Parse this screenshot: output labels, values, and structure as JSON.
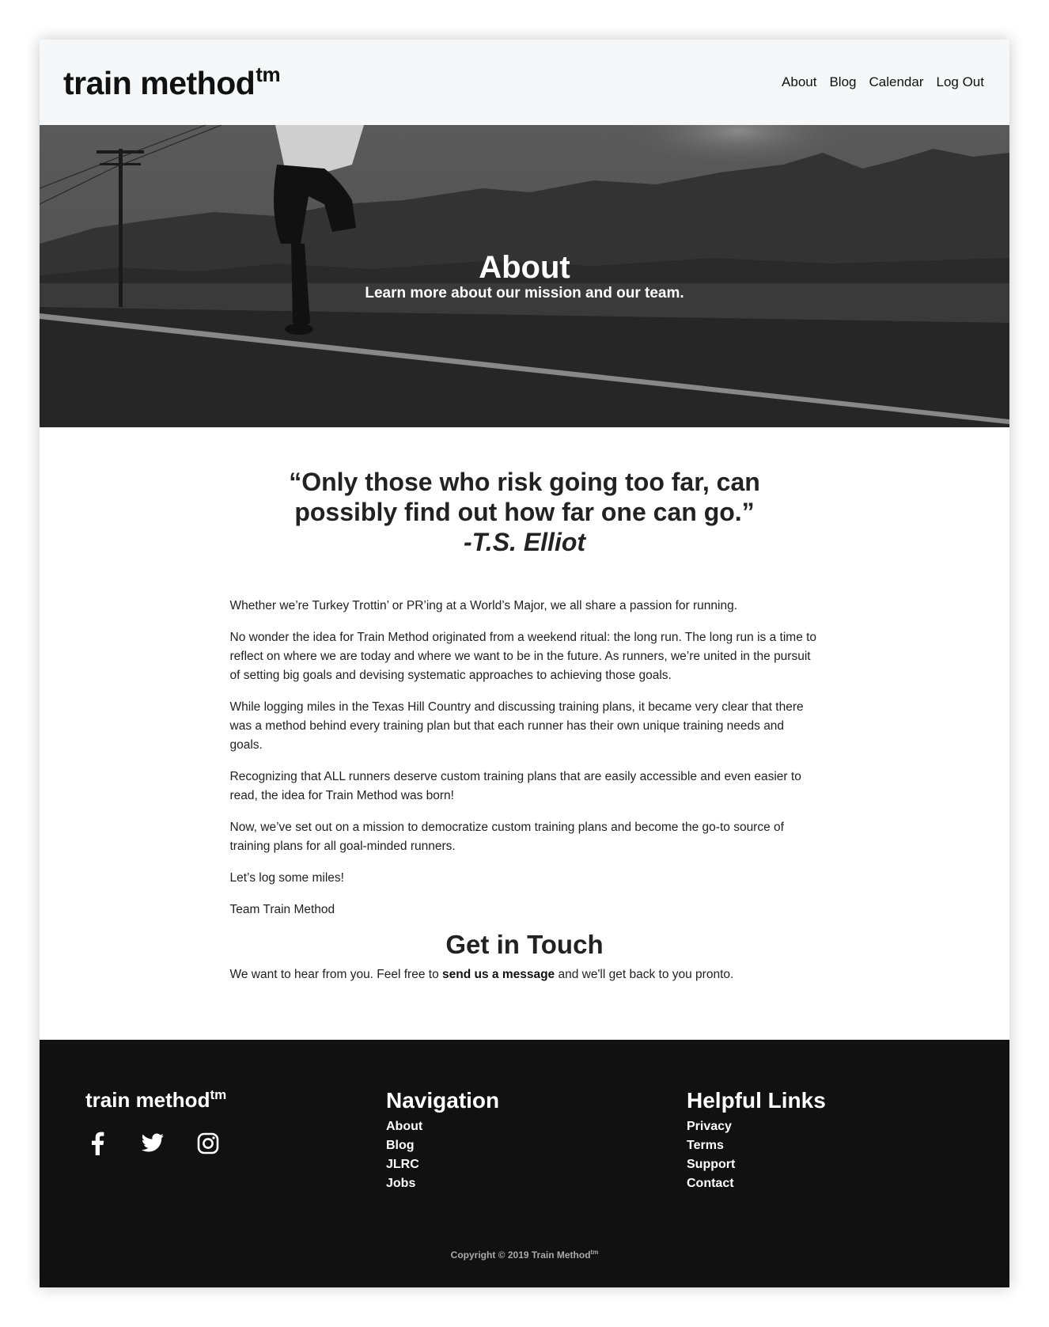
{
  "header": {
    "logo_text": "train method",
    "logo_mark": "tm",
    "nav": [
      "About",
      "Blog",
      "Calendar",
      "Log Out"
    ]
  },
  "hero": {
    "title": "About",
    "subtitle": "Learn more about our mission and our team."
  },
  "quote": {
    "line1": "“Only those who risk going too far, can",
    "line2": "possibly find out how far one can go.”",
    "author": "-T.S. Elliot"
  },
  "body": {
    "paragraphs": [
      "Whether we’re Turkey Trottin’ or PR’ing at a World’s Major, we all share a passion for running.",
      "No wonder the idea for Train Method originated from a weekend ritual: the long run. The long run is a time to reflect on where we are today and where we want to be in the future. As runners, we’re united in the pursuit of setting big goals and devising systematic approaches to achieving those goals.",
      "While logging miles in the Texas Hill Country and discussing training plans, it became very clear that there was a method behind every training plan but that each runner has their own unique training needs and goals.",
      "Recognizing that ALL runners deserve custom training plans that are easily accessible and even easier to read, the idea for Train Method was born!",
      "Now, we’ve set out on a mission to democratize custom training plans and become the go-to source of training plans for all goal-minded runners.",
      "Let’s log some miles!",
      "Team Train Method"
    ]
  },
  "contact": {
    "heading": "Get in Touch",
    "text_before": "We want to hear from you. Feel free to ",
    "link": "send us a message",
    "text_after": " and we'll get back to you pronto."
  },
  "footer": {
    "logo_text": "train method",
    "logo_mark": "tm",
    "socials": [
      "facebook-icon",
      "twitter-icon",
      "instagram-icon"
    ],
    "navigation": {
      "heading": "Navigation",
      "links": [
        "About",
        "Blog",
        "JLRC",
        "Jobs"
      ]
    },
    "helpful": {
      "heading": "Helpful Links",
      "links": [
        "Privacy",
        "Terms",
        "Support",
        "Contact"
      ]
    },
    "copyright": "Copyright © 2019 Train Method",
    "copyright_mark": "tm"
  }
}
